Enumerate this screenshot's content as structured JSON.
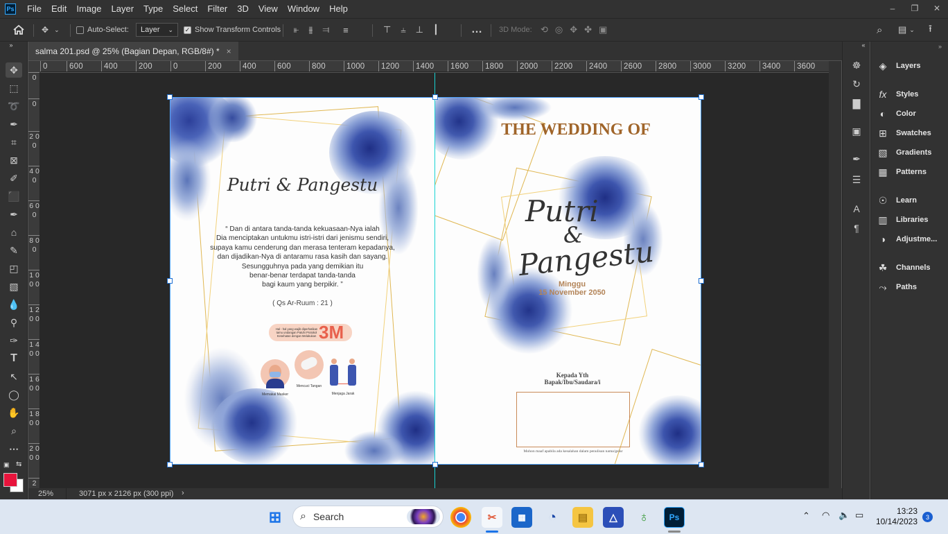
{
  "app": {
    "logo": "Ps"
  },
  "menu": [
    "File",
    "Edit",
    "Image",
    "Layer",
    "Type",
    "Select",
    "Filter",
    "3D",
    "View",
    "Window",
    "Help"
  ],
  "options": {
    "auto_select_label": "Auto-Select:",
    "auto_select_checked": false,
    "layer_select": "Layer",
    "show_transform_label": "Show Transform Controls",
    "show_transform_checked": true,
    "mode_3d_label": "3D Mode:"
  },
  "document_tab": {
    "title": "salma 201.psd @ 25% (Bagian Depan, RGB/8#) *",
    "close": "×"
  },
  "ruler_h": [
    "0",
    "600",
    "400",
    "200",
    "0",
    "200",
    "400",
    "600",
    "800",
    "1000",
    "1200",
    "1400",
    "1600",
    "1800",
    "2000",
    "2200",
    "2400",
    "2600",
    "2800",
    "3000",
    "3200",
    "3400",
    "3600"
  ],
  "ruler_v": [
    "0",
    "0",
    "2 0 0",
    "4 0 0",
    "6 0 0",
    "8 0 0",
    "1 0 0 0",
    "1 2 0 0",
    "1 4 0 0",
    "1 6 0 0",
    "1 8 0 0",
    "2 0 0 0",
    "2"
  ],
  "status": {
    "zoom": "25%",
    "dimensions": "3071 px x 2126 px (300 ppi)",
    "arrow": "›"
  },
  "panels": [
    {
      "label": "Layers",
      "icon": "layers-icon"
    },
    {
      "label": "Styles",
      "icon": "fx-icon"
    },
    {
      "label": "Color",
      "icon": "palette-icon"
    },
    {
      "label": "Swatches",
      "icon": "grid-icon"
    },
    {
      "label": "Gradients",
      "icon": "gradient-icon"
    },
    {
      "label": "Patterns",
      "icon": "patterns-icon"
    },
    {
      "label": "Learn",
      "icon": "bulb-icon"
    },
    {
      "label": "Libraries",
      "icon": "libraries-icon"
    },
    {
      "label": "Adjustme...",
      "icon": "adjustments-icon"
    },
    {
      "label": "Channels",
      "icon": "channels-icon"
    },
    {
      "label": "Paths",
      "icon": "paths-icon"
    }
  ],
  "left_page": {
    "names": "Putri & Pangestu",
    "quote": [
      "“ Dan di antara tanda-tanda kekuasaan-Nya ialah",
      "Dia menciptakan untukmu istri-istri  dari jenismu sendiri,",
      "supaya kamu cenderung dan merasa tenteram kepadanya,",
      "dan dijadikan-Nya di antaramu rasa kasih dan sayang.",
      "Sesungguhnya pada yang demikian itu",
      "benar-benar terdapat tanda-tanda",
      "bagi kaum yang berpikir. ”"
    ],
    "source": "( Qs Ar-Ruum : 21 )",
    "banner_text": "Hal - hal yang wajib diperhatikan tamu undangan Patuhi Protokol Kesehatan dengan Melakukan",
    "banner_big": "3M",
    "items": [
      "Memakai Masker",
      "Mencuci Tangan",
      "Menjaga Jarak"
    ]
  },
  "right_page": {
    "title": "THE WEDDING OF",
    "name1": "Putri",
    "amp": "&",
    "name2": "Pangestu",
    "day": "Minggu",
    "date": "15 November 2050",
    "to1": "Kepada Yth",
    "to2": "Bapak/Ibu/Saudara/i",
    "note": "Mohon maaf apabila ada kesalahan dalam penulisan nama/gelar"
  },
  "taskbar": {
    "search": "Search",
    "time": "13:23",
    "date": "10/14/2023",
    "notifications": "3",
    "ps_label": "Ps"
  },
  "colors": {
    "foreground": "#e8143c",
    "background": "#ffffff",
    "gold": "#e0b752",
    "title_brown": "#a0652a"
  }
}
